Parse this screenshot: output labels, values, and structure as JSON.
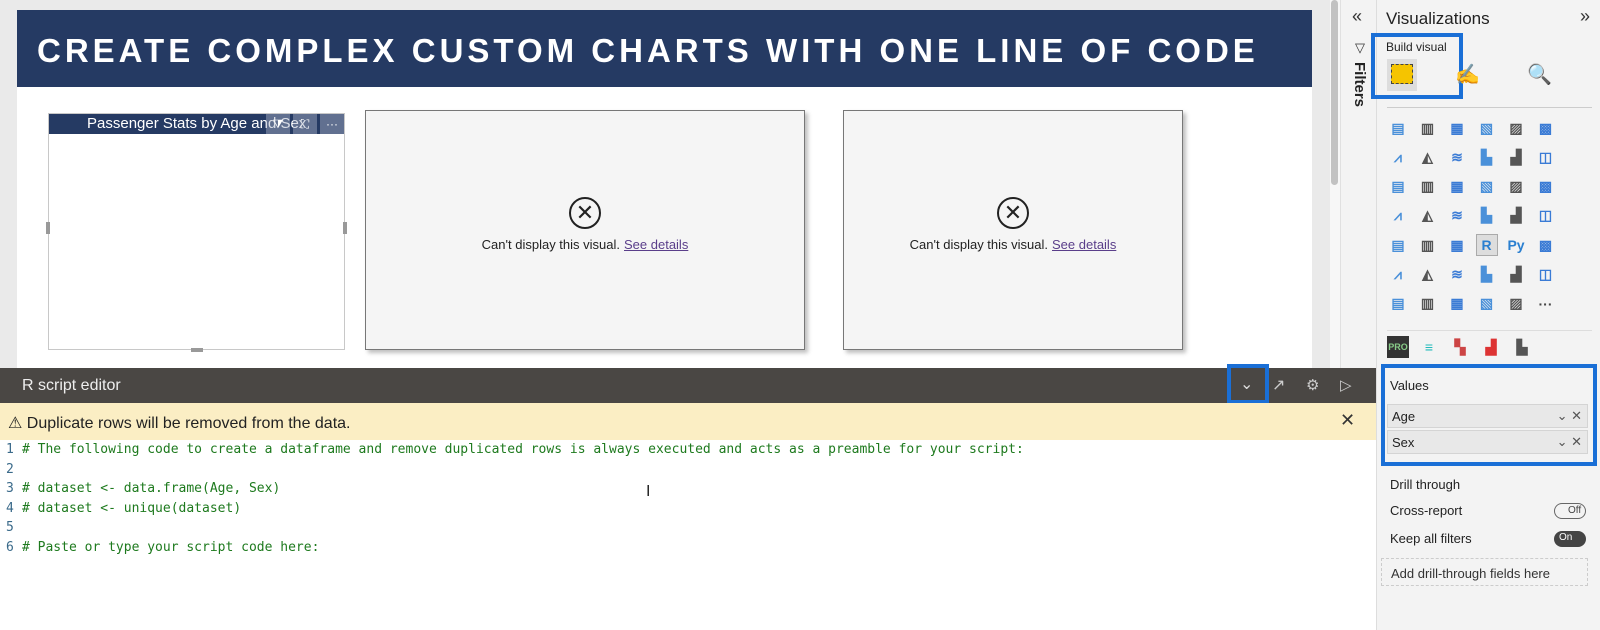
{
  "banner": {
    "title": "CREATE COMPLEX CUSTOM CHARTS WITH ONE LINE OF CODE"
  },
  "visual1": {
    "title": "Passenger Stats by Age and Sex",
    "more": "···"
  },
  "error_visuals": [
    {
      "message": "Can't display this visual.",
      "link": "See details"
    },
    {
      "message": "Can't display this visual.",
      "link": "See details"
    }
  ],
  "filters": {
    "label": "Filters"
  },
  "visualizations": {
    "title": "Visualizations",
    "build_visual": "Build visual",
    "icons": [
      "stacked-bar",
      "stacked-column",
      "clustered-bar",
      "clustered-column",
      "100-bar",
      "100-column",
      "line",
      "area",
      "stacked-area",
      "line-column",
      "line-clustered",
      "ribbon",
      "waterfall",
      "funnel",
      "scatter",
      "donut",
      "treemap",
      "map",
      "filled-map",
      "shape-map",
      "gauge",
      "card",
      "multi-row-card",
      "kpi",
      "slicer",
      "table",
      "matrix",
      "r-visual",
      "python-visual",
      "key-influencers",
      "decomposition-tree",
      "qa",
      "smart-narrative",
      "goals",
      "paginated",
      "power-apps",
      "power-automate",
      "arcgis",
      "html-content",
      "deneb",
      "chart-visual",
      "more"
    ],
    "icon_glyphs": {
      "r-visual": "R",
      "python-visual": "Py",
      "more": "···"
    },
    "values_label": "Values",
    "fields": [
      "Age",
      "Sex"
    ],
    "drill_through": "Drill through",
    "cross_report": "Cross-report",
    "cross_report_state": "Off",
    "keep_filters": "Keep all filters",
    "keep_filters_state": "On",
    "add_drill": "Add drill-through fields here"
  },
  "editor": {
    "title": "R script editor",
    "warning": "Duplicate rows will be removed from the data.",
    "lines": [
      "# The following code to create a dataframe and remove duplicated rows is always executed and acts as a preamble for your script:",
      "",
      "# dataset <- data.frame(Age, Sex)",
      "# dataset <- unique(dataset)",
      "",
      "# Paste or type your script code here:"
    ]
  },
  "colors": {
    "banner": "#253a63",
    "highlight": "#1a6fd6",
    "warning_bg": "#fbeec4"
  }
}
